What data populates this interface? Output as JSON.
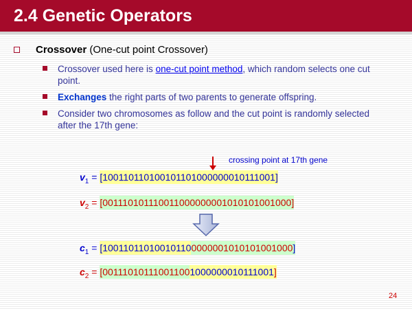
{
  "title": "2.4 Genetic Operators",
  "l1": {
    "bold": "Crossover",
    "rest": " (One-cut point Crossover)"
  },
  "b1": {
    "pre": "Crossover used here is ",
    "link": "one-cut point method",
    "post": ", which random selects one cut point."
  },
  "b2": {
    "bold": "Exchanges",
    "rest": " the right parts of two parents to generate offspring."
  },
  "b3": {
    "text": "Consider two chromosomes as follow and the cut point is randomly selected after the 17th gene:"
  },
  "annotation": "crossing point at 17th gene",
  "v1": {
    "name": "v",
    "sub": "1",
    "eq": " = ",
    "open": "[",
    "left": "10011011010010110",
    "right": "1000000010111001",
    "close": "]"
  },
  "v2": {
    "name": "v",
    "sub": "2",
    "eq": " = ",
    "open": "[",
    "left": "00111010111001100",
    "right": "0000001010101001000",
    "close": "]"
  },
  "c1": {
    "name": "c",
    "sub": "1",
    "eq": " = ",
    "open": "[",
    "left": "10011011010010110",
    "right": "0000001010101001000",
    "close": "]"
  },
  "c2": {
    "name": "c",
    "sub": "2",
    "eq": " = ",
    "open": "[",
    "left": "00111010111001100",
    "right": "1000000010111001",
    "close": "]"
  },
  "page_number": "24",
  "colors": {
    "title_bg": "#a50a2a",
    "blue": "#0000cc",
    "red": "#cc0000",
    "yellow": "#ffff99",
    "green": "#ccffcc"
  }
}
